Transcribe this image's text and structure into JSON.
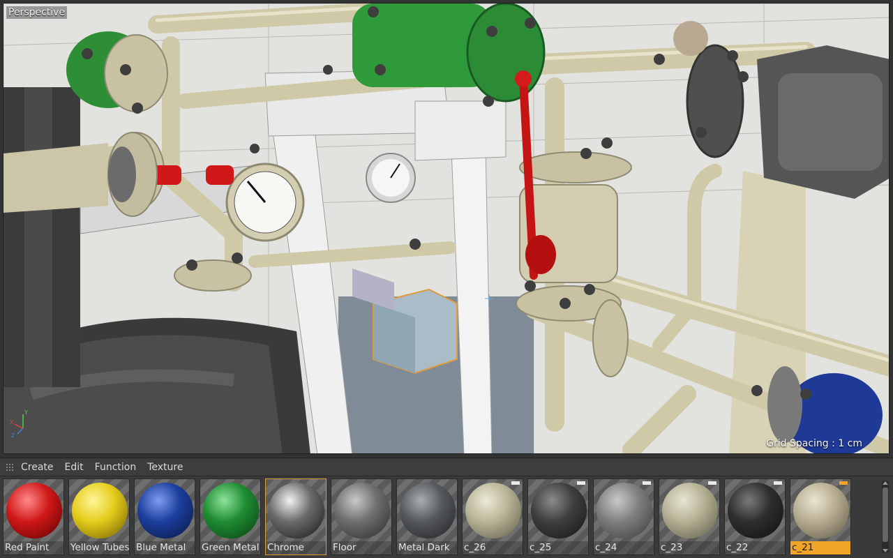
{
  "viewport": {
    "label": "Perspective",
    "grid_spacing": "Grid Spacing : 1 cm",
    "axis": {
      "x": "X",
      "y": "Y",
      "z": "Z"
    }
  },
  "material_manager": {
    "menu": [
      "Create",
      "Edit",
      "Function",
      "Texture"
    ],
    "materials": [
      {
        "name": "Red Paint",
        "base": "#d01818",
        "light": "#ff8a8a",
        "dark": "#5a0000",
        "flag": false
      },
      {
        "name": "Yellow Tubes",
        "base": "#e5cd1c",
        "light": "#fff59a",
        "dark": "#6d5a00",
        "flag": false
      },
      {
        "name": "Blue Metal",
        "base": "#1c3e9c",
        "light": "#7e9cf0",
        "dark": "#0a1640",
        "flag": false
      },
      {
        "name": "Green Metal",
        "base": "#1e8c32",
        "light": "#8fe39b",
        "dark": "#0a3c12",
        "flag": false
      },
      {
        "name": "Chrome",
        "base": "#6a6a6a",
        "light": "#f2f2f2",
        "dark": "#151515",
        "flag": false
      },
      {
        "name": "Floor",
        "base": "#6e6e6e",
        "light": "#c9c9c9",
        "dark": "#2a2a2a",
        "flag": false
      },
      {
        "name": "Metal Dark",
        "base": "#55585c",
        "light": "#a9adb2",
        "dark": "#1f2124",
        "flag": false
      },
      {
        "name": "c_26",
        "base": "#b8b496",
        "light": "#ecead7",
        "dark": "#5c5a46",
        "flag": true
      },
      {
        "name": "c_25",
        "base": "#3e3e3e",
        "light": "#8c8c8c",
        "dark": "#141414",
        "flag": true
      },
      {
        "name": "c_24",
        "base": "#7e7e7e",
        "light": "#c9c9c9",
        "dark": "#3a3a3a",
        "flag": true
      },
      {
        "name": "c_23",
        "base": "#b3b093",
        "light": "#e8e6d3",
        "dark": "#5a5846",
        "flag": true
      },
      {
        "name": "c_22",
        "base": "#2e2e2e",
        "light": "#7a7a7a",
        "dark": "#0f0f0f",
        "flag": true
      },
      {
        "name": "c_21",
        "base": "#b7ad92",
        "light": "#ebe4d0",
        "dark": "#5e5644",
        "flag": true
      }
    ],
    "active_index": 12,
    "highlight_index": 4
  }
}
